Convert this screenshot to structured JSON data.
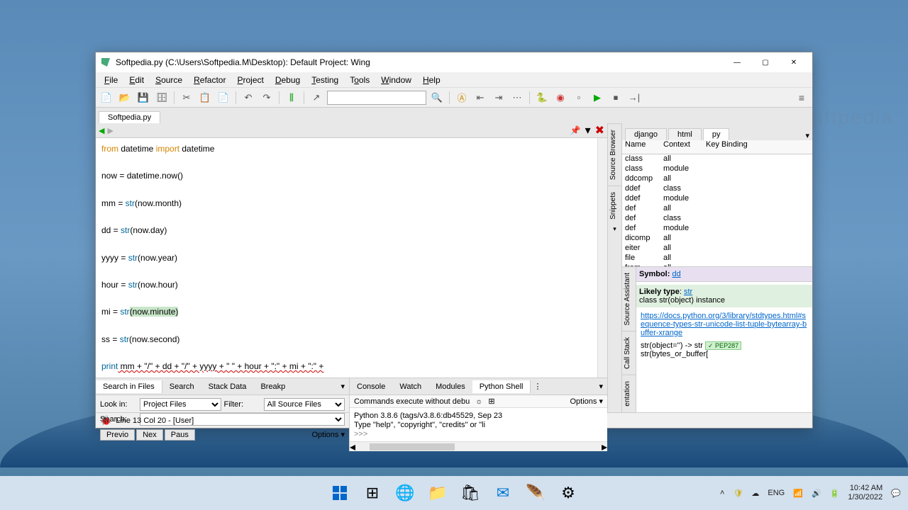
{
  "title": "Softpedia.py (C:\\Users\\Softpedia.M\\Desktop): Default Project: Wing",
  "menus": [
    "File",
    "Edit",
    "Source",
    "Refactor",
    "Project",
    "Debug",
    "Testing",
    "Tools",
    "Window",
    "Help"
  ],
  "file_tab": "Softpedia.py",
  "code": {
    "l1a": "from",
    "l1b": " datetime ",
    "l1c": "import",
    "l1d": " datetime",
    "l2a": "now = datetime.now()",
    "l3a": "mm = ",
    "l3b": "str",
    "l3c": "(now.month)",
    "l4a": "dd = ",
    "l4b": "str",
    "l4c": "(now.day)",
    "l5a": "yyyy = ",
    "l5b": "str",
    "l5c": "(now.year)",
    "l6a": "hour = ",
    "l6b": "str",
    "l6c": "(now.hour)",
    "l7a": "mi = ",
    "l7b": "str",
    "l7c": "(now.minute)",
    "l8a": "ss = ",
    "l8b": "str",
    "l8c": "(now.second)",
    "l9a": "print",
    "l9b": " mm + \"/\" + dd + \"/\" + yyyy + \" \" + hour + \":\" + mi + \":\" +"
  },
  "bottom_left": {
    "tabs": [
      "Search in Files",
      "Search",
      "Stack Data",
      "Breakp"
    ],
    "look_in_label": "Look in:",
    "look_in": "Project Files",
    "filter_label": "Filter:",
    "filter": "All Source Files",
    "search_label": "Search:",
    "btns": [
      "Previo",
      "Nex",
      "Paus"
    ],
    "options": "Options"
  },
  "bottom_right": {
    "tabs": [
      "Console",
      "Watch",
      "Modules",
      "Python Shell"
    ],
    "cmd_hint": "Commands execute without debu",
    "options": "Options",
    "line1": "Python 3.8.6 (tags/v3.8.6:db45529, Sep 23",
    "line2": "Type \"help\", \"copyright\", \"credits\" or \"li",
    "prompt": ">>>"
  },
  "browser": {
    "tabs": [
      "django",
      "html",
      "py"
    ],
    "head": [
      "Name",
      "Context",
      "Key Binding"
    ],
    "rows": [
      [
        "class",
        "all"
      ],
      [
        "class",
        "module"
      ],
      [
        "ddcomp",
        "all"
      ],
      [
        "ddef",
        "class"
      ],
      [
        "ddef",
        "module"
      ],
      [
        "def",
        "all"
      ],
      [
        "def",
        "class"
      ],
      [
        "def",
        "module"
      ],
      [
        "dicomp",
        "all"
      ],
      [
        "eiter",
        "all"
      ],
      [
        "file",
        "all"
      ],
      [
        "from",
        "all"
      ]
    ]
  },
  "side_tabs_top": [
    "Source Browser",
    "Snippets"
  ],
  "side_tabs_bot": [
    "Source Assistant",
    "Call Stack",
    "entation"
  ],
  "assist": {
    "symbol_label": "Symbol:",
    "symbol": "dd",
    "type_label": "Likely type",
    "type": "str",
    "type_desc": "class str(object) instance",
    "link": "https://docs.python.org/3/library/stdtypes.html#sequence-types-str-unicode-list-tuple-bytearray-buffer-xrange",
    "sig1": "str(object='') -> str",
    "pep": "✓ PEP287",
    "sig2": "str(bytes_or_buffer["
  },
  "status": "Line 13 Col 20 - [User]",
  "taskbar": {
    "lang": "ENG",
    "time": "10:42 AM",
    "date": "1/30/2022"
  }
}
